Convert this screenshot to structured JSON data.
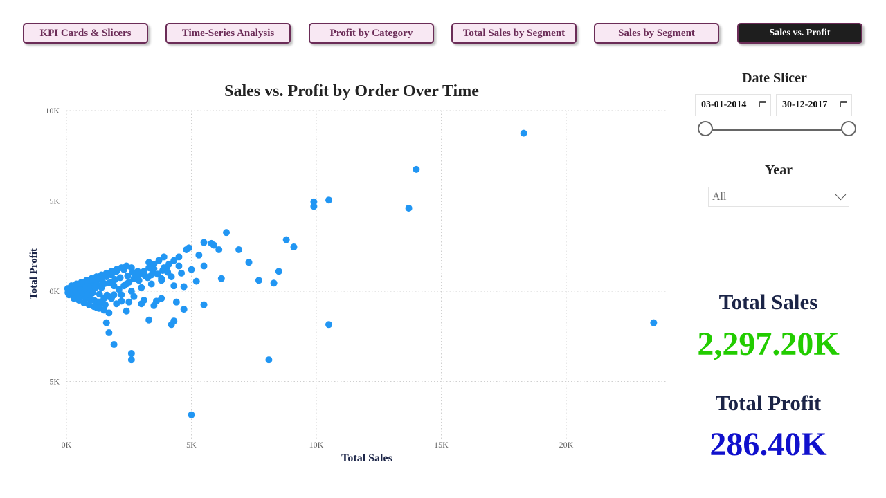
{
  "nav": {
    "tabs": [
      {
        "label": "KPI Cards & Slicers"
      },
      {
        "label": "Time-Series Analysis"
      },
      {
        "label": "Profit by Category"
      },
      {
        "label": "Total Sales by Segment"
      },
      {
        "label": "Sales by Segment"
      },
      {
        "label": "Sales vs. Profit"
      }
    ]
  },
  "date_slicer": {
    "title": "Date Slicer",
    "start": "03-01-2014",
    "end": "30-12-2017"
  },
  "year_slicer": {
    "title": "Year",
    "selected": "All"
  },
  "kpis": {
    "sales_label": "Total Sales",
    "sales_value": "2,297.20K",
    "profit_label": "Total Profit",
    "profit_value": "286.40K"
  },
  "colors": {
    "points": "#2196f3",
    "sales_value": "#22cc00",
    "profit_value": "#1010cc",
    "tab_border": "#6b2c57"
  },
  "chart_data": {
    "type": "scatter",
    "title": "Sales vs. Profit by Order Over Time",
    "xlabel": "Total Sales",
    "ylabel": "Total Profit",
    "xlim": [
      0,
      24000
    ],
    "ylim": [
      -7500,
      10000
    ],
    "xticks": [
      {
        "v": 0,
        "label": "0K"
      },
      {
        "v": 5000,
        "label": "5K"
      },
      {
        "v": 10000,
        "label": "10K"
      },
      {
        "v": 15000,
        "label": "15K"
      },
      {
        "v": 20000,
        "label": "20K"
      }
    ],
    "yticks": [
      {
        "v": 10000,
        "label": "10K"
      },
      {
        "v": 5000,
        "label": "5K"
      },
      {
        "v": 0,
        "label": "0K"
      },
      {
        "v": -5000,
        "label": "-5K"
      }
    ],
    "grid": true,
    "points": [
      [
        18300,
        8750
      ],
      [
        14000,
        6750
      ],
      [
        10500,
        5050
      ],
      [
        9900,
        4950
      ],
      [
        9900,
        4700
      ],
      [
        13700,
        4600
      ],
      [
        6400,
        3250
      ],
      [
        8800,
        2850
      ],
      [
        9100,
        2450
      ],
      [
        5500,
        2700
      ],
      [
        5800,
        2650
      ],
      [
        5900,
        2550
      ],
      [
        4900,
        2400
      ],
      [
        4800,
        2300
      ],
      [
        6900,
        2300
      ],
      [
        6100,
        2300
      ],
      [
        5300,
        2000
      ],
      [
        7300,
        1600
      ],
      [
        5500,
        1400
      ],
      [
        8500,
        1100
      ],
      [
        6200,
        700
      ],
      [
        7700,
        600
      ],
      [
        8300,
        450
      ],
      [
        23500,
        -1750
      ],
      [
        10500,
        -1850
      ],
      [
        8100,
        -3800
      ],
      [
        5000,
        -6850
      ],
      [
        2600,
        -3450
      ],
      [
        2600,
        -3800
      ],
      [
        1900,
        -2950
      ],
      [
        1700,
        -2300
      ],
      [
        1600,
        -1750
      ],
      [
        4200,
        -1850
      ],
      [
        4300,
        -1650
      ],
      [
        3300,
        -1600
      ],
      [
        4700,
        -1000
      ],
      [
        5500,
        -750
      ],
      [
        4400,
        -600
      ],
      [
        3600,
        -550
      ],
      [
        3800,
        -400
      ],
      [
        2400,
        -1100
      ],
      [
        1700,
        -1200
      ],
      [
        1200,
        -900
      ],
      [
        2200,
        -550
      ],
      [
        3100,
        -500
      ],
      [
        2700,
        -300
      ],
      [
        4700,
        250
      ],
      [
        5200,
        550
      ],
      [
        4300,
        300
      ],
      [
        3800,
        700
      ],
      [
        3000,
        1000
      ],
      [
        3500,
        1250
      ],
      [
        4000,
        1300
      ],
      [
        4500,
        1400
      ],
      [
        3300,
        1600
      ],
      [
        2600,
        1300
      ],
      [
        2300,
        1200
      ],
      [
        2000,
        1100
      ],
      [
        1800,
        900
      ],
      [
        1600,
        800
      ],
      [
        1400,
        700
      ],
      [
        1200,
        600
      ],
      [
        1000,
        500
      ],
      [
        800,
        400
      ],
      [
        600,
        300
      ],
      [
        400,
        200
      ],
      [
        200,
        100
      ],
      [
        100,
        50
      ],
      [
        300,
        -100
      ],
      [
        500,
        -200
      ],
      [
        700,
        -300
      ],
      [
        900,
        -400
      ],
      [
        1100,
        -500
      ],
      [
        1300,
        -600
      ],
      [
        1500,
        -400
      ],
      [
        1700,
        -300
      ],
      [
        1900,
        -200
      ],
      [
        2100,
        100
      ],
      [
        2300,
        300
      ],
      [
        2500,
        500
      ],
      [
        2700,
        700
      ],
      [
        2900,
        900
      ],
      [
        3100,
        1100
      ],
      [
        3300,
        1300
      ],
      [
        3500,
        1500
      ],
      [
        3700,
        1700
      ],
      [
        3900,
        1900
      ],
      [
        4100,
        1500
      ],
      [
        4300,
        1700
      ],
      [
        4500,
        1900
      ],
      [
        3900,
        1300
      ],
      [
        3400,
        900
      ],
      [
        2900,
        600
      ],
      [
        2400,
        400
      ],
      [
        1900,
        300
      ],
      [
        1400,
        200
      ],
      [
        1000,
        100
      ],
      [
        600,
        50
      ],
      [
        300,
        20
      ],
      [
        150,
        -50
      ],
      [
        350,
        -150
      ],
      [
        550,
        -250
      ],
      [
        750,
        -350
      ],
      [
        950,
        -450
      ],
      [
        1150,
        -550
      ],
      [
        1350,
        -650
      ],
      [
        1550,
        -750
      ],
      [
        2000,
        -700
      ],
      [
        2500,
        -600
      ],
      [
        3000,
        -700
      ],
      [
        3500,
        -800
      ],
      [
        1800,
        -400
      ],
      [
        2200,
        -200
      ],
      [
        2600,
        0
      ],
      [
        3000,
        200
      ],
      [
        3400,
        400
      ],
      [
        3800,
        600
      ],
      [
        4200,
        800
      ],
      [
        4600,
        1000
      ],
      [
        5000,
        1200
      ],
      [
        200,
        300
      ],
      [
        400,
        400
      ],
      [
        600,
        500
      ],
      [
        800,
        600
      ],
      [
        1000,
        700
      ],
      [
        1200,
        800
      ],
      [
        1400,
        900
      ],
      [
        1600,
        1000
      ],
      [
        1800,
        1100
      ],
      [
        2000,
        1200
      ],
      [
        2200,
        1300
      ],
      [
        2400,
        1400
      ],
      [
        100,
        -200
      ],
      [
        300,
        -400
      ],
      [
        500,
        -500
      ],
      [
        700,
        -650
      ],
      [
        900,
        -750
      ],
      [
        1100,
        -850
      ],
      [
        1300,
        -950
      ],
      [
        1500,
        -1050
      ],
      [
        50,
        150
      ],
      [
        250,
        250
      ],
      [
        450,
        350
      ],
      [
        650,
        450
      ],
      [
        850,
        550
      ],
      [
        1050,
        650
      ],
      [
        1250,
        750
      ],
      [
        1450,
        850
      ],
      [
        1650,
        950
      ],
      [
        1850,
        1050
      ],
      [
        120,
        -20
      ],
      [
        220,
        60
      ],
      [
        320,
        140
      ],
      [
        420,
        -80
      ],
      [
        520,
        100
      ],
      [
        620,
        180
      ],
      [
        720,
        -40
      ],
      [
        820,
        220
      ],
      [
        920,
        260
      ],
      [
        1020,
        -120
      ],
      [
        1120,
        300
      ],
      [
        1220,
        340
      ],
      [
        1320,
        -160
      ],
      [
        1420,
        380
      ],
      [
        1520,
        420
      ],
      [
        1620,
        -220
      ],
      [
        1720,
        460
      ],
      [
        1820,
        500
      ],
      [
        60,
        -80
      ],
      [
        160,
        -120
      ],
      [
        260,
        -60
      ],
      [
        360,
        40
      ],
      [
        460,
        -140
      ],
      [
        560,
        60
      ],
      [
        660,
        -100
      ],
      [
        760,
        120
      ],
      [
        860,
        -180
      ],
      [
        960,
        160
      ],
      [
        1060,
        -60
      ],
      [
        1160,
        200
      ],
      [
        2750,
        950
      ],
      [
        2850,
        1100
      ],
      [
        3150,
        850
      ],
      [
        3250,
        750
      ],
      [
        3450,
        1050
      ],
      [
        3650,
        950
      ],
      [
        3850,
        1150
      ],
      [
        4050,
        1050
      ],
      [
        2450,
        850
      ],
      [
        2650,
        1050
      ],
      [
        2150,
        750
      ],
      [
        1950,
        650
      ]
    ]
  }
}
